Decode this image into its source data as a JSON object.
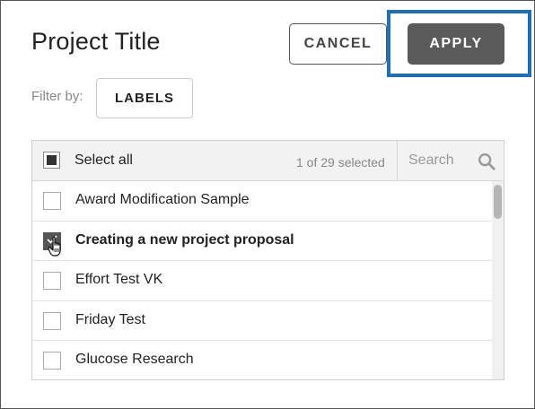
{
  "header": {
    "title": "Project Title",
    "cancel_label": "CANCEL",
    "apply_label": "APPLY"
  },
  "filter": {
    "label": "Filter by:",
    "labels_button": "LABELS"
  },
  "list": {
    "select_all_label": "Select all",
    "selected_count": "1 of 29 selected",
    "search_placeholder": "Search",
    "items": [
      {
        "label": "Award Modification Sample",
        "checked": false
      },
      {
        "label": "Creating a new project proposal",
        "checked": true
      },
      {
        "label": "Effort Test VK",
        "checked": false
      },
      {
        "label": "Friday Test",
        "checked": false
      },
      {
        "label": "Glucose Research",
        "checked": false
      }
    ]
  },
  "icons": {
    "search": "search-icon",
    "cursor": "hand-pointer-icon",
    "check": "checkmark-icon"
  },
  "colors": {
    "apply_bg": "#5a5a5a",
    "highlight_border": "#1f6fb2",
    "header_bg": "#f2f2f2"
  }
}
